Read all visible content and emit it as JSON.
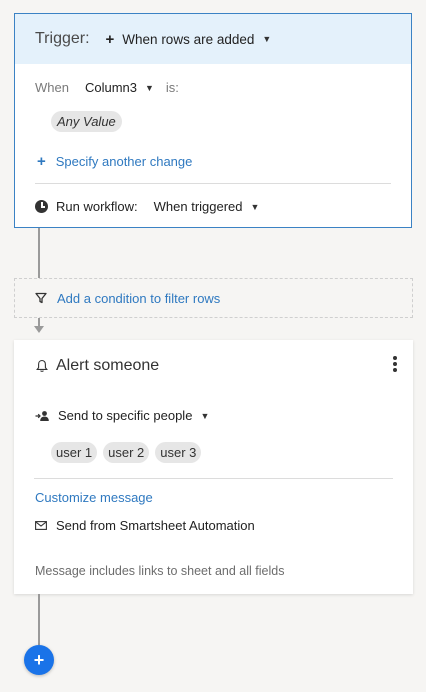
{
  "trigger": {
    "title": "Trigger:",
    "event_label": "When rows are added",
    "when_label": "When",
    "column_label": "Column3",
    "is_label": "is:",
    "value_chip": "Any Value",
    "specify_label": "Specify another change",
    "run_label": "Run workflow:",
    "run_value": "When triggered"
  },
  "filter": {
    "label": "Add a condition to filter rows"
  },
  "action": {
    "title": "Alert someone",
    "send_to_label": "Send to specific people",
    "recipients": [
      "user 1",
      "user 2",
      "user 3"
    ],
    "customize_label": "Customize message",
    "send_from_label": "Send from Smartsheet Automation",
    "includes_label": "Message includes links to sheet and all fields"
  },
  "icons": {
    "add_trigger": "plus-icon",
    "clock": "clock-icon",
    "filter": "funnel-icon",
    "bell": "bell-icon",
    "menu": "kebab-menu-icon",
    "people": "people-icon",
    "mail": "mail-icon",
    "add_step": "plus-circle-icon"
  },
  "colors": {
    "accent": "#2f79c0",
    "trigger_border": "#3b82c4",
    "trigger_header_bg": "#e4f1fb",
    "add_button": "#1a73e8"
  }
}
